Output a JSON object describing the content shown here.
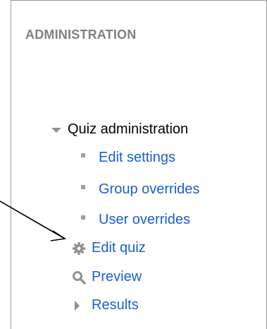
{
  "block": {
    "title": "ADMINISTRATION"
  },
  "tree": {
    "root_label": "Quiz administration",
    "items": [
      {
        "label": "Edit settings",
        "icon": "bullet-icon"
      },
      {
        "label": "Group overrides",
        "icon": "bullet-icon"
      },
      {
        "label": "User overrides",
        "icon": "bullet-icon"
      },
      {
        "label": "Edit quiz",
        "icon": "gear-icon"
      },
      {
        "label": "Preview",
        "icon": "magnifier-icon"
      },
      {
        "label": "Results",
        "icon": "triangle-right-icon"
      }
    ]
  },
  "colors": {
    "link": "#1a5fcf",
    "heading": "#808080",
    "icon": "#909090"
  }
}
